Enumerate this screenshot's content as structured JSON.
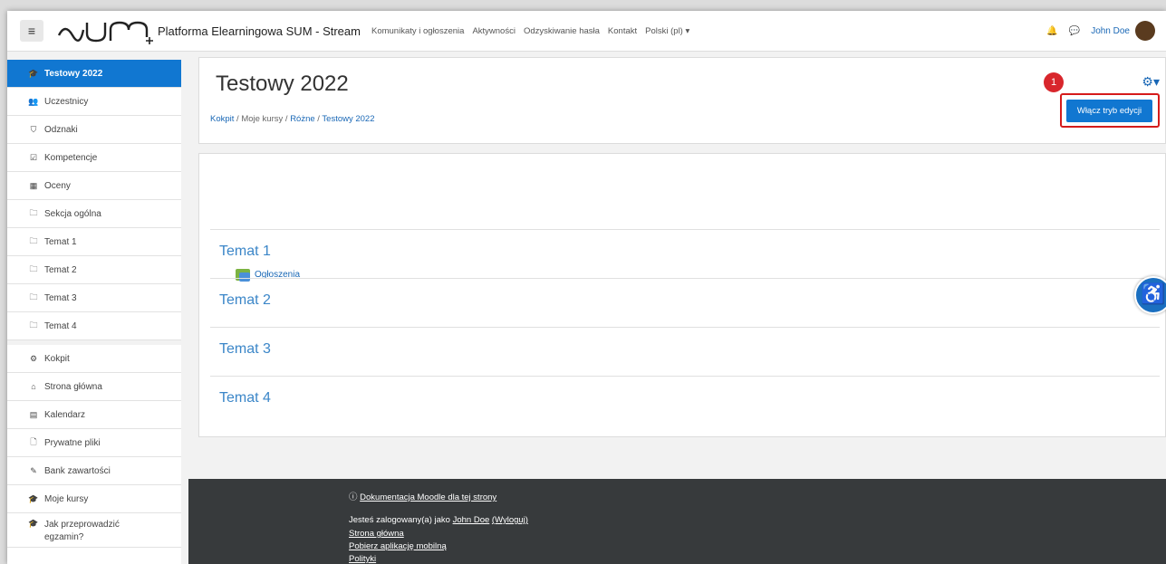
{
  "navbar": {
    "menu_glyph": "≡",
    "site_name": "Platforma Elearningowa SUM - Stream",
    "links": [
      "Komunikaty i ogłoszenia",
      "Aktywności",
      "Odzyskiwanie hasła",
      "Kontakt",
      "Polski (pl) ▾"
    ],
    "user_name": "John Doe",
    "bell_glyph": "🔔",
    "chat_glyph": "💬",
    "user_menu_caret": "▾"
  },
  "sidebar": {
    "items": [
      {
        "label": "Testowy 2022",
        "icon": "graduation-cap-icon",
        "glyph": "🎓"
      },
      {
        "label": "Uczestnicy",
        "icon": "users-icon",
        "glyph": "👥"
      },
      {
        "label": "Odznaki",
        "icon": "shield-icon",
        "glyph": "⛉"
      },
      {
        "label": "Kompetencje",
        "icon": "checkbox-icon",
        "glyph": "☑"
      },
      {
        "label": "Oceny",
        "icon": "table-icon",
        "glyph": "▦"
      },
      {
        "label": "Sekcja ogólna",
        "icon": "folder-icon",
        "glyph": "🗀"
      },
      {
        "label": "Temat 1",
        "icon": "folder-icon",
        "glyph": "🗀"
      },
      {
        "label": "Temat 2",
        "icon": "folder-icon",
        "glyph": "🗀"
      },
      {
        "label": "Temat 3",
        "icon": "folder-icon",
        "glyph": "🗀"
      },
      {
        "label": "Temat 4",
        "icon": "folder-icon",
        "glyph": "🗀"
      }
    ],
    "items2": [
      {
        "label": "Kokpit",
        "icon": "dashboard-icon",
        "glyph": "⚙"
      },
      {
        "label": "Strona główna",
        "icon": "home-icon",
        "glyph": "⌂"
      },
      {
        "label": "Kalendarz",
        "icon": "calendar-icon",
        "glyph": "▤"
      },
      {
        "label": "Prywatne pliki",
        "icon": "file-icon",
        "glyph": "🗋"
      },
      {
        "label": "Bank zawartości",
        "icon": "brush-icon",
        "glyph": "✎"
      },
      {
        "label": "Moje kursy",
        "icon": "graduation-cap-icon",
        "glyph": "🎓"
      },
      {
        "label": "Jak przeprowadzić egzamin?",
        "icon": "graduation-cap-icon",
        "glyph": "🎓"
      }
    ]
  },
  "header": {
    "title": "Testowy 2022",
    "breadcrumb": [
      "Kokpit",
      "Moje kursy",
      "Różne",
      "Testowy 2022"
    ],
    "breadcrumb_separator": "/",
    "gear_glyph": "⚙▾",
    "edit_button": "Włącz tryb edycji",
    "step_badge": "1"
  },
  "content": {
    "announcements": "Ogłoszenia",
    "topics": [
      "Temat 1",
      "Temat 2",
      "Temat 3",
      "Temat 4"
    ]
  },
  "accessibility_glyph": "♿",
  "footer": {
    "docs_icon": "ⓘ",
    "docs": "Dokumentacja Moodle dla tej strony",
    "logged_prefix": "Jesteś zalogowany(a) jako",
    "user": "John Doe",
    "logout": "(Wyloguj)",
    "home": "Strona główna",
    "mobile": "Pobierz aplikację mobilną",
    "policies": "Polityki"
  },
  "colors": {
    "primary": "#1177d1",
    "footer": "#373a3c",
    "badge": "#d8262c",
    "link": "#1a68b6"
  }
}
